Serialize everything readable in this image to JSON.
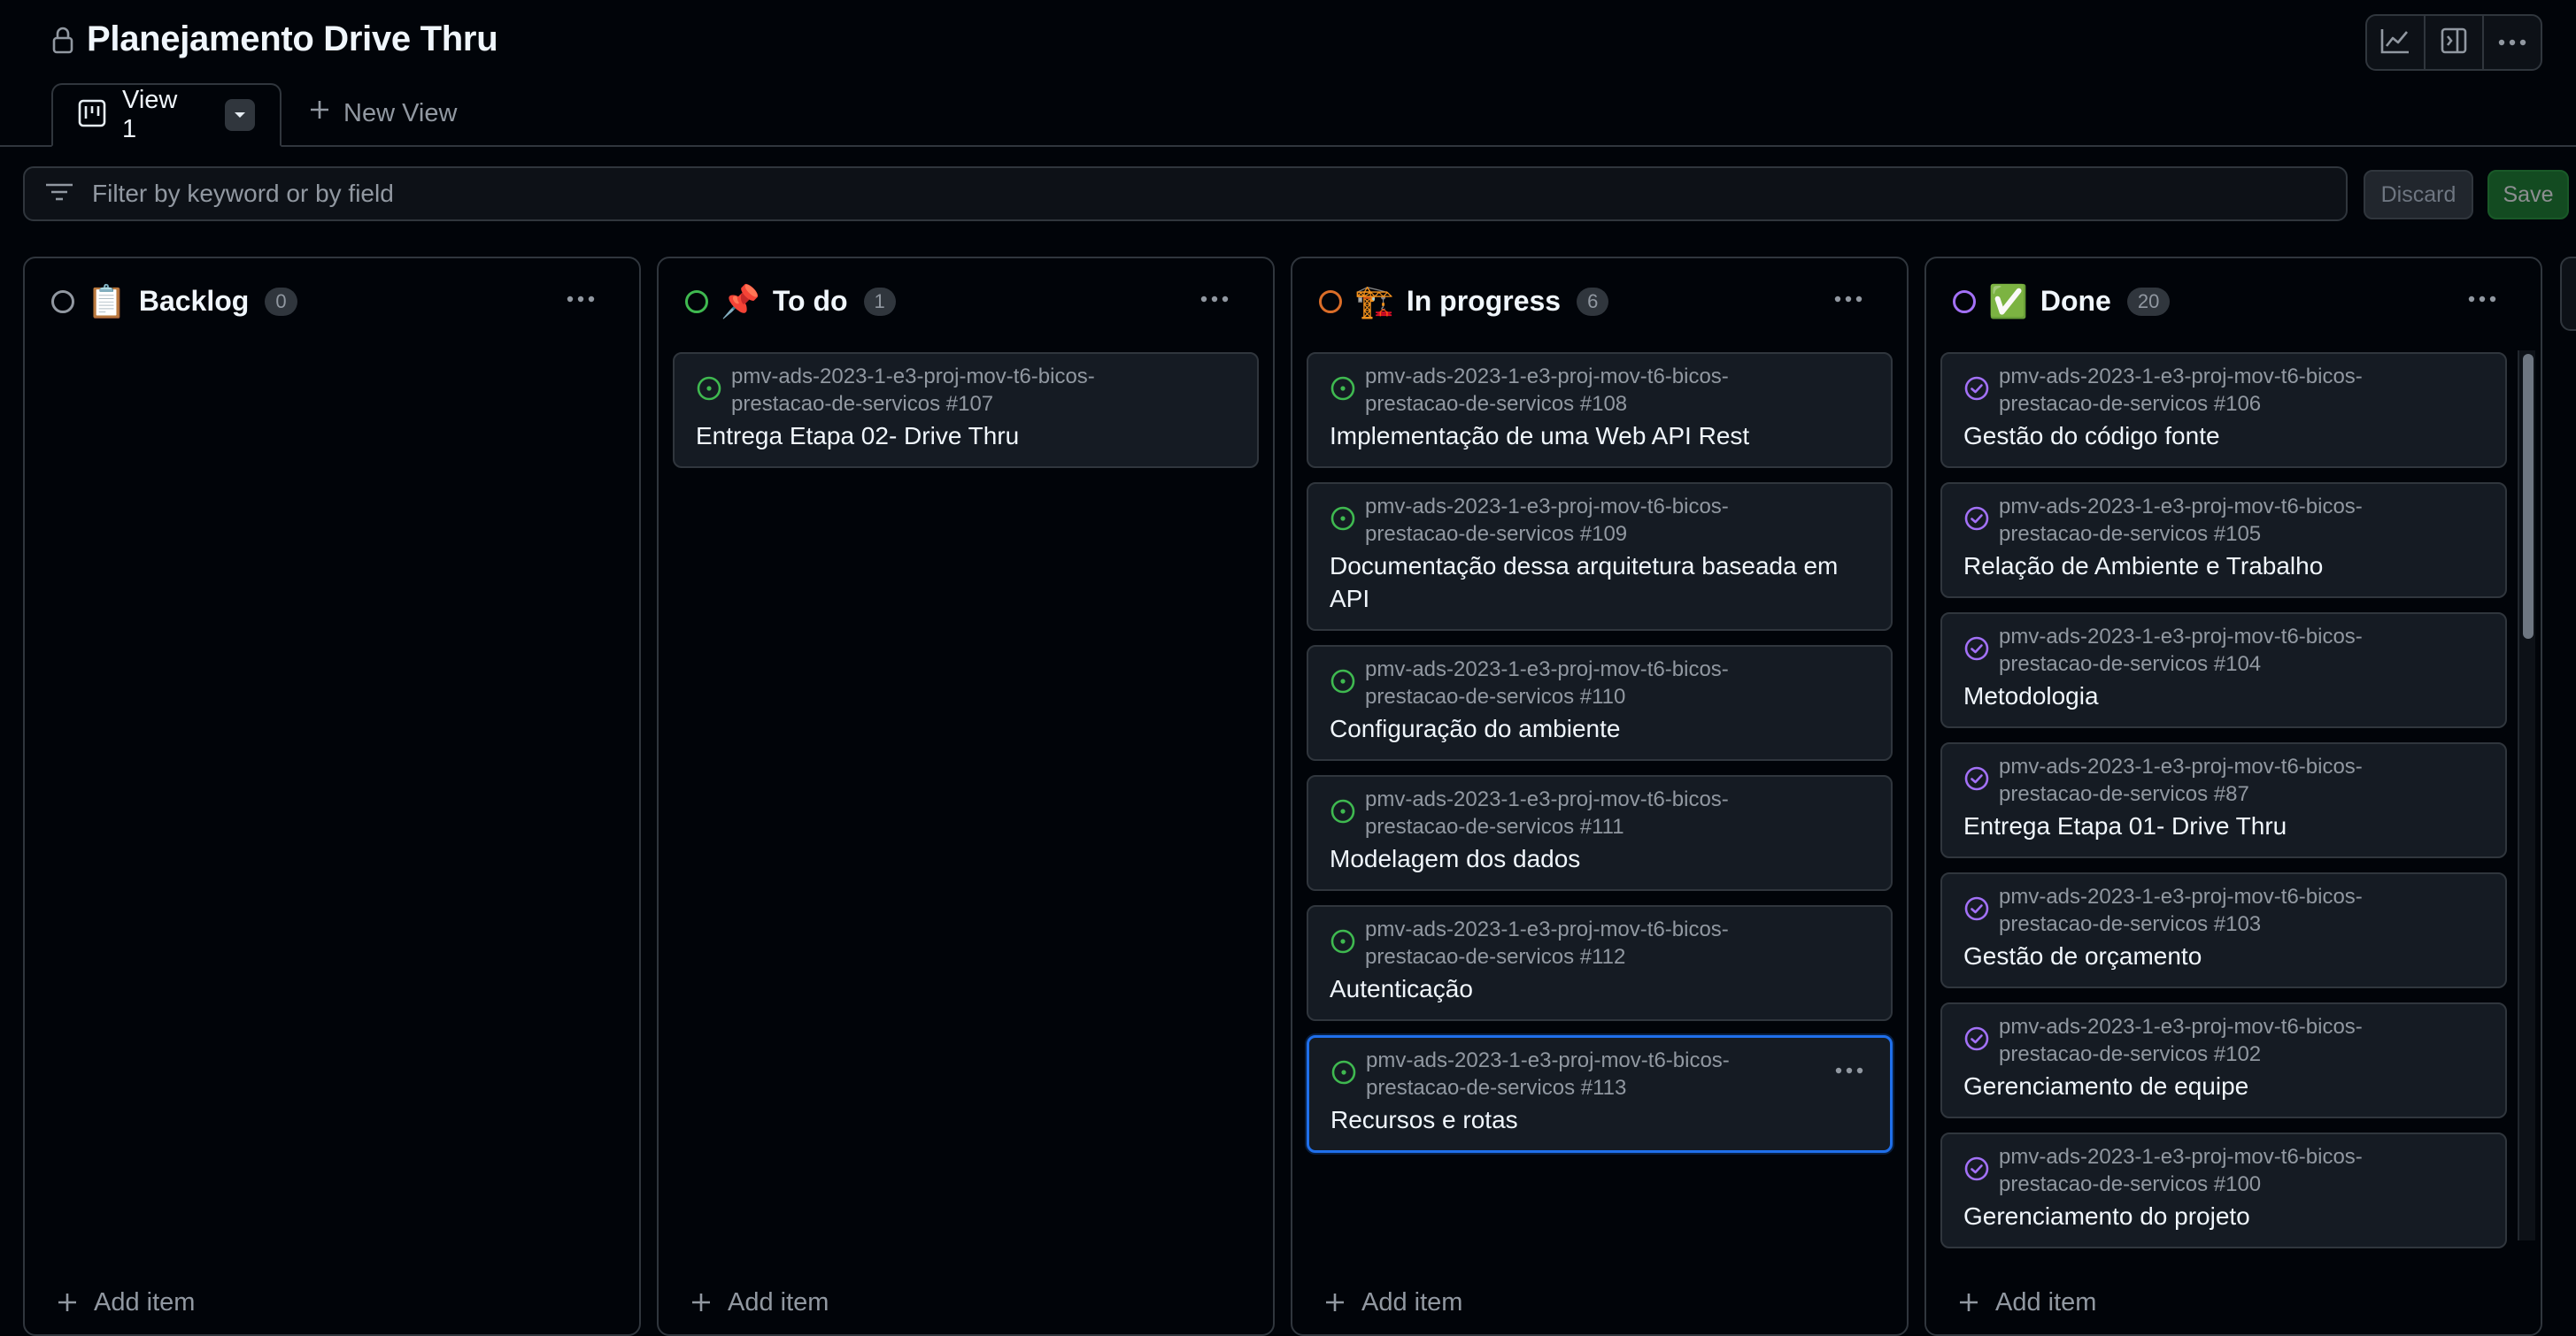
{
  "project": {
    "title": "Planejamento Drive Thru"
  },
  "tabs": [
    {
      "label": "View 1"
    }
  ],
  "new_view_label": "New View",
  "filter": {
    "placeholder": "Filter by keyword or by field",
    "value": ""
  },
  "actions": {
    "discard_label": "Discard",
    "save_label": "Save"
  },
  "add_item_label": "Add item",
  "columns": [
    {
      "emoji": "📋",
      "title": "Backlog",
      "count": "0",
      "status_color": "#9198a1",
      "cards": []
    },
    {
      "emoji": "📌",
      "title": "To do",
      "count": "1",
      "status_color": "#3fb950",
      "cards": [
        {
          "repo": "pmv-ads-2023-1-e3-proj-mov-t6-bicos-prestacao-de-servicos #107",
          "title": "Entrega Etapa 02- Drive Thru"
        }
      ]
    },
    {
      "emoji": "🏗️",
      "title": "In progress",
      "count": "6",
      "status_color": "#db6d28",
      "cards": [
        {
          "repo": "pmv-ads-2023-1-e3-proj-mov-t6-bicos-prestacao-de-servicos #108",
          "title": "Implementação de uma Web API Rest"
        },
        {
          "repo": "pmv-ads-2023-1-e3-proj-mov-t6-bicos-prestacao-de-servicos #109",
          "title": "Documentação dessa arquitetura baseada em API"
        },
        {
          "repo": "pmv-ads-2023-1-e3-proj-mov-t6-bicos-prestacao-de-servicos #110",
          "title": "Configuração do ambiente"
        },
        {
          "repo": "pmv-ads-2023-1-e3-proj-mov-t6-bicos-prestacao-de-servicos #111",
          "title": "Modelagem dos dados"
        },
        {
          "repo": "pmv-ads-2023-1-e3-proj-mov-t6-bicos-prestacao-de-servicos #112",
          "title": "Autenticação"
        },
        {
          "repo": "pmv-ads-2023-1-e3-proj-mov-t6-bicos-prestacao-de-servicos #113",
          "title": "Recursos e rotas"
        }
      ]
    },
    {
      "emoji": "✅",
      "title": "Done",
      "count": "20",
      "status_color": "#a371f7",
      "cards": [
        {
          "repo": "pmv-ads-2023-1-e3-proj-mov-t6-bicos-prestacao-de-servicos #106",
          "title": "Gestão do código fonte"
        },
        {
          "repo": "pmv-ads-2023-1-e3-proj-mov-t6-bicos-prestacao-de-servicos #105",
          "title": "Relação de Ambiente e Trabalho"
        },
        {
          "repo": "pmv-ads-2023-1-e3-proj-mov-t6-bicos-prestacao-de-servicos #104",
          "title": "Metodologia"
        },
        {
          "repo": "pmv-ads-2023-1-e3-proj-mov-t6-bicos-prestacao-de-servicos #87",
          "title": "Entrega Etapa 01- Drive Thru"
        },
        {
          "repo": "pmv-ads-2023-1-e3-proj-mov-t6-bicos-prestacao-de-servicos #103",
          "title": "Gestão de orçamento"
        },
        {
          "repo": "pmv-ads-2023-1-e3-proj-mov-t6-bicos-prestacao-de-servicos #102",
          "title": "Gerenciamento de equipe"
        },
        {
          "repo": "pmv-ads-2023-1-e3-proj-mov-t6-bicos-prestacao-de-servicos #100",
          "title": "Gerenciamento do projeto"
        }
      ]
    }
  ],
  "colors": {
    "open_issue": "#3fb950",
    "closed_issue": "#a371f7",
    "selected_border": "#1f6feb",
    "save_green": "#238636"
  },
  "icons": {
    "lock": "lock-icon",
    "insights": "graph-icon",
    "side_panel": "sidebar-expand-icon",
    "menu": "kebab-horizontal-icon",
    "board_view": "project-board-icon",
    "filter": "filter-icon",
    "add": "plus-icon",
    "open_issue": "issue-opened-icon",
    "closed_issue": "issue-closed-icon"
  }
}
